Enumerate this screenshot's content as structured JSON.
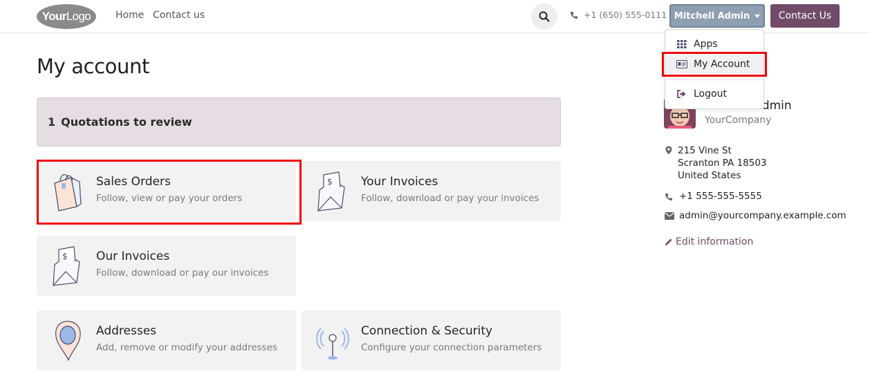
{
  "header": {
    "logo_bold": "Your",
    "logo_light": "Logo",
    "nav": [
      "Home",
      "Contact us"
    ],
    "phone": "+1 (650) 555-0111",
    "user_name": "Mitchell Admin",
    "contact_button": "Contact Us"
  },
  "user_menu": {
    "items": [
      {
        "label": "Apps",
        "icon": "grid-icon"
      },
      {
        "label": "My Account",
        "icon": "id-card-icon"
      },
      {
        "label": "Logout",
        "icon": "logout-icon"
      }
    ]
  },
  "page": {
    "title": "My account",
    "alert_count": "1",
    "alert_text": "Quotations to review"
  },
  "cards": [
    {
      "title": "Sales Orders",
      "desc": "Follow, view or pay your orders",
      "icon": "shopping-bag-icon"
    },
    {
      "title": "Your Invoices",
      "desc": "Follow, download or pay your invoices",
      "icon": "invoice-envelope-icon"
    },
    {
      "title": "Our Invoices",
      "desc": "Follow, download or pay our invoices",
      "icon": "invoice-envelope-icon"
    },
    {
      "title": "Addresses",
      "desc": "Add, remove or modify your addresses",
      "icon": "map-pin-icon"
    },
    {
      "title": "Connection & Security",
      "desc": "Configure your connection parameters",
      "icon": "signal-tower-icon"
    }
  ],
  "profile": {
    "name": "Mitchell Admin",
    "company": "YourCompany",
    "address": [
      "215 Vine St",
      "Scranton PA 18503",
      "United States"
    ],
    "phone": "+1 555-555-5555",
    "email": "admin@yourcompany.example.com",
    "edit_label": "Edit information"
  },
  "colors": {
    "brand": "#714b67",
    "user_button": "#8d9fb0",
    "highlight": "#ee0000",
    "alert_bg": "#e6dde4"
  }
}
